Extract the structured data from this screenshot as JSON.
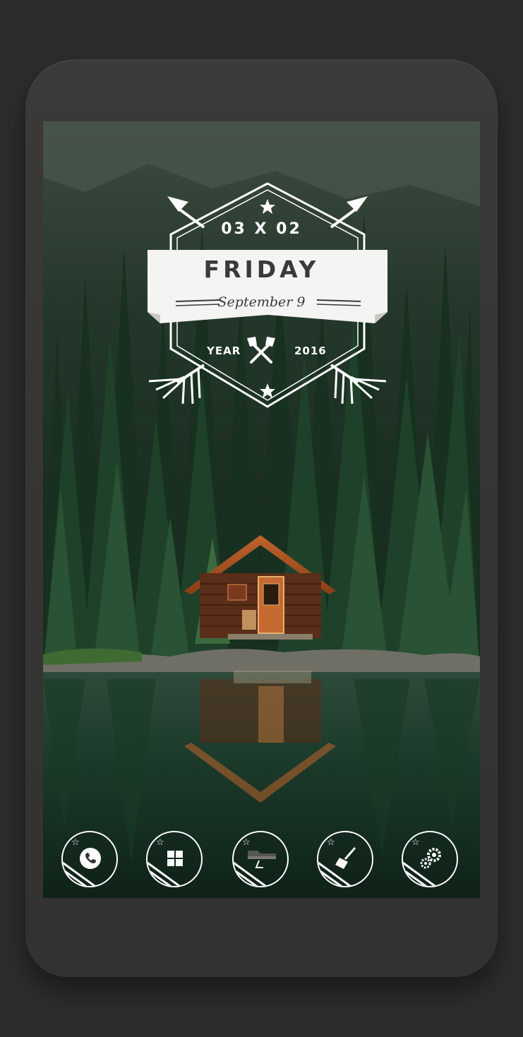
{
  "widget": {
    "date_numeric": "03 X 02",
    "weekday": "FRIDAY",
    "month_day": "September 9",
    "year_label": "YEAR",
    "year_value": "2016",
    "emblem_icon": "crossed-axes-icon"
  },
  "dock": {
    "apps": [
      {
        "name": "phone",
        "icon": "phone-icon"
      },
      {
        "name": "windows",
        "icon": "windows-icon"
      },
      {
        "name": "folder",
        "icon": "folder-icon"
      },
      {
        "name": "cleaner",
        "icon": "broom-icon"
      },
      {
        "name": "settings",
        "icon": "gear-icon"
      }
    ]
  },
  "colors": {
    "frame": "#363533",
    "badge_line": "#ffffff",
    "banner": "#f4f4f2",
    "banner_text": "#3a3a3a"
  }
}
